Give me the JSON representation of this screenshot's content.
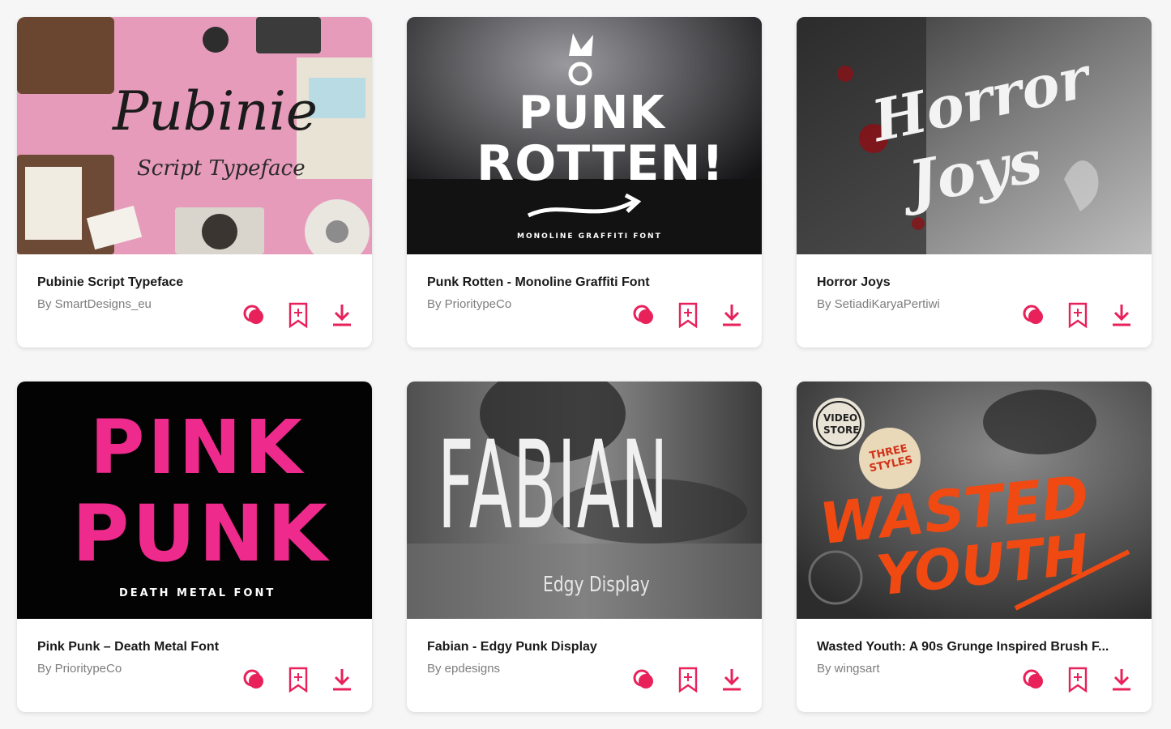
{
  "colors": {
    "accent": "#e8215a",
    "title": "#1a1a1a",
    "author": "#7d7d7d",
    "card_bg": "#ffffff",
    "page_bg": "#f6f6f7"
  },
  "icons": {
    "preview": "preview-circles-icon",
    "bookmark": "bookmark-add-icon",
    "download": "download-icon"
  },
  "cards": [
    {
      "title": "Pubinie Script Typeface",
      "author": "By SmartDesigns_eu",
      "art": {
        "main": "Pubinie",
        "sub": "Script Typeface"
      }
    },
    {
      "title": "Punk Rotten - Monoline Graffiti Font",
      "author": "By PrioritypeCo",
      "art": {
        "main1": "PUNK",
        "main2": "ROTTEN!",
        "sub": "MONOLINE GRAFFITI FONT"
      }
    },
    {
      "title": "Horror Joys",
      "author": "By SetiadiKaryaPertiwi",
      "art": {
        "main1": "Horror",
        "main2": "Joys"
      }
    },
    {
      "title": "Pink Punk – Death Metal Font",
      "author": "By PrioritypeCo",
      "art": {
        "main1": "PINK",
        "main2": "PUNK",
        "sub": "DEATH METAL FONT"
      }
    },
    {
      "title": "Fabian - Edgy Punk Display",
      "author": "By epdesigns",
      "art": {
        "main": "FABIAN",
        "sub": "Edgy Display"
      }
    },
    {
      "title": "Wasted Youth: A 90s Grunge Inspired Brush F...",
      "author": "By wingsart",
      "art": {
        "main1": "WASTED",
        "main2": "YOUTH",
        "badge1a": "VIDEO",
        "badge1b": "STORE",
        "badge2": "THREE STYLES"
      }
    }
  ]
}
